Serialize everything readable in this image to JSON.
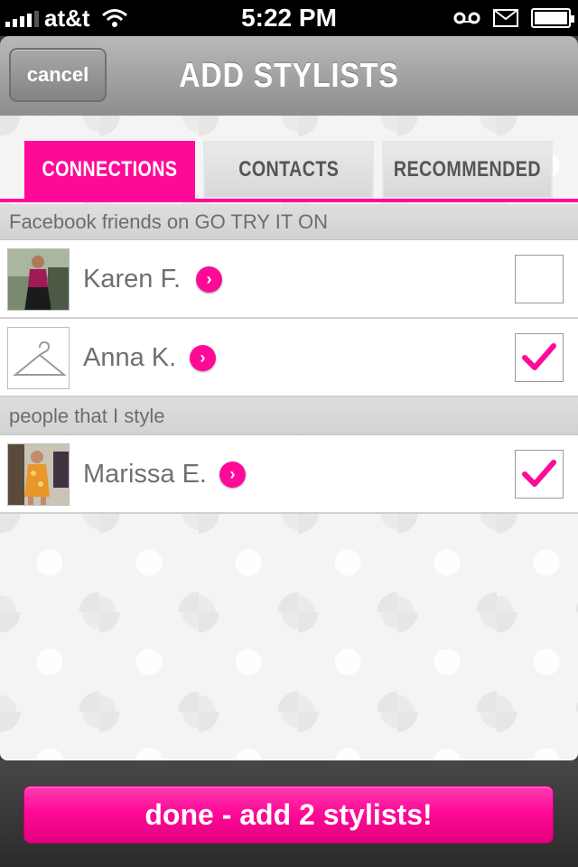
{
  "status_bar": {
    "carrier": "at&t",
    "time": "5:22 PM",
    "icons": [
      "signal-icon",
      "wifi-icon",
      "voicemail-icon",
      "mail-icon",
      "battery-icon"
    ]
  },
  "nav": {
    "cancel_label": "cancel",
    "title": "ADD STYLISTS"
  },
  "tabs": [
    {
      "label": "CONNECTIONS",
      "active": true
    },
    {
      "label": "CONTACTS",
      "active": false
    },
    {
      "label": "RECOMMENDED",
      "active": false
    }
  ],
  "sections": [
    {
      "header": "Facebook friends on GO TRY IT ON",
      "rows": [
        {
          "name": "Karen F.",
          "checked": false,
          "avatar": "photo-avatar"
        },
        {
          "name": "Anna K.",
          "checked": true,
          "avatar": "hanger-icon"
        }
      ]
    },
    {
      "header": "people that I style",
      "rows": [
        {
          "name": "Marissa E.",
          "checked": true,
          "avatar": "photo-avatar"
        }
      ]
    }
  ],
  "footer": {
    "done_label": "done - add 2 stylists!"
  },
  "colors": {
    "accent": "#ff0a98",
    "nav_gray": "#9f9f9f",
    "text_gray": "#707070"
  }
}
